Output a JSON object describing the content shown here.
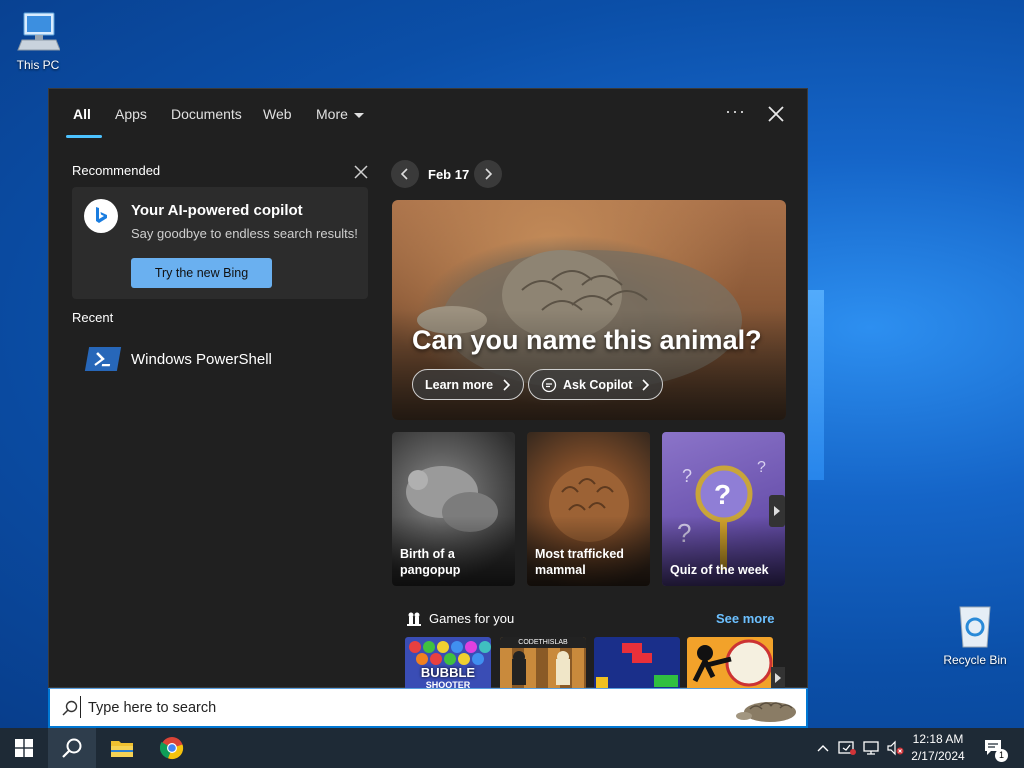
{
  "desktop": {
    "icons": [
      {
        "label": "This PC",
        "icon": "computer-icon"
      },
      {
        "label": "Recycle Bin",
        "icon": "recycle-bin-icon"
      }
    ]
  },
  "search_panel": {
    "tabs": [
      {
        "label": "All",
        "active": true
      },
      {
        "label": "Apps"
      },
      {
        "label": "Documents"
      },
      {
        "label": "Web"
      },
      {
        "label": "More"
      }
    ],
    "options_icon": "ellipsis-icon",
    "close_icon": "close-icon",
    "recommended": {
      "title": "Recommended",
      "copilot_card": {
        "title": "Your AI-powered copilot",
        "subtitle": "Say goodbye to endless search results!",
        "button": "Try the new Bing"
      }
    },
    "recent": {
      "title": "Recent",
      "items": [
        {
          "label": "Windows PowerShell",
          "icon": "powershell-icon"
        }
      ]
    },
    "highlights": {
      "date": "Feb 17",
      "hero": {
        "title": "Can you name this animal?",
        "learn_more": "Learn more",
        "ask_copilot": "Ask Copilot"
      },
      "cards": [
        {
          "line1": "Birth of a",
          "line2": "pangopup"
        },
        {
          "line1": "Most trafficked",
          "line2": "mammal"
        },
        {
          "line1": "Quiz of the week",
          "line2": ""
        }
      ],
      "games": {
        "title": "Games for you",
        "see_more": "See more",
        "tiles": [
          {
            "label": "BUBBLE",
            "sub": "SHOOTER"
          },
          {
            "label": "CODETHISLAB"
          },
          {
            "label": ""
          },
          {
            "label": ""
          }
        ]
      }
    }
  },
  "search_box": {
    "placeholder": "Type here to search"
  },
  "taskbar": {
    "time": "12:18 AM",
    "date": "2/17/2024",
    "notification_count": "1"
  },
  "colors": {
    "accent": "#4cc2ff",
    "panel_bg": "#202020",
    "taskbar_bg": "#1e2a36",
    "bing_button": "#6ab0f0"
  }
}
